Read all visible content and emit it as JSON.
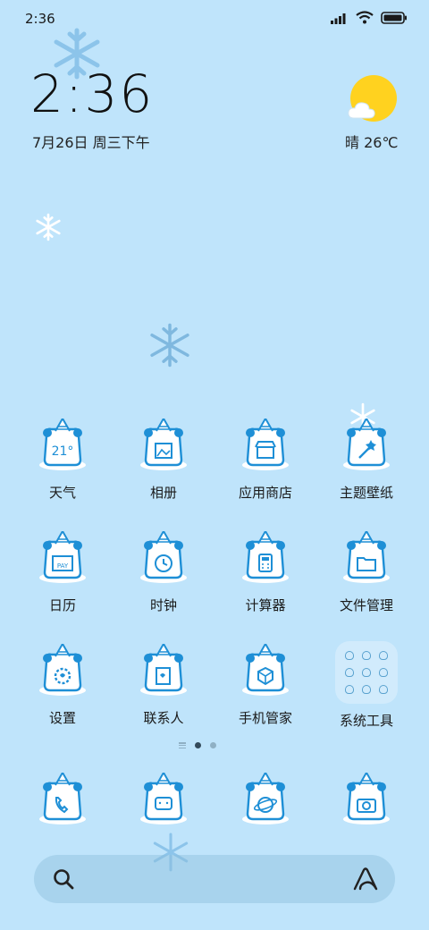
{
  "status_bar": {
    "time": "2:36"
  },
  "clock_widget": {
    "time": "2:36",
    "date": "7月26日 周三下午"
  },
  "weather_widget": {
    "text": "晴 26℃"
  },
  "apps": [
    {
      "label": "天气",
      "icon": "weather-app-icon"
    },
    {
      "label": "相册",
      "icon": "gallery-app-icon"
    },
    {
      "label": "应用商店",
      "icon": "app-store-icon"
    },
    {
      "label": "主题壁纸",
      "icon": "themes-app-icon"
    },
    {
      "label": "日历",
      "icon": "calendar-app-icon"
    },
    {
      "label": "时钟",
      "icon": "clock-app-icon"
    },
    {
      "label": "计算器",
      "icon": "calculator-app-icon"
    },
    {
      "label": "文件管理",
      "icon": "file-manager-icon"
    },
    {
      "label": "设置",
      "icon": "settings-app-icon"
    },
    {
      "label": "联系人",
      "icon": "contacts-app-icon"
    },
    {
      "label": "手机管家",
      "icon": "security-app-icon"
    },
    {
      "label": "系统工具",
      "icon": "system-tools-folder-icon"
    }
  ],
  "dock": [
    {
      "icon": "phone-app-icon"
    },
    {
      "icon": "messages-app-icon"
    },
    {
      "icon": "browser-app-icon"
    },
    {
      "icon": "camera-app-icon"
    }
  ],
  "colors": {
    "background": "#bfe4fb",
    "icon_stroke": "#1e8fd6",
    "sun": "#ffd21f"
  }
}
